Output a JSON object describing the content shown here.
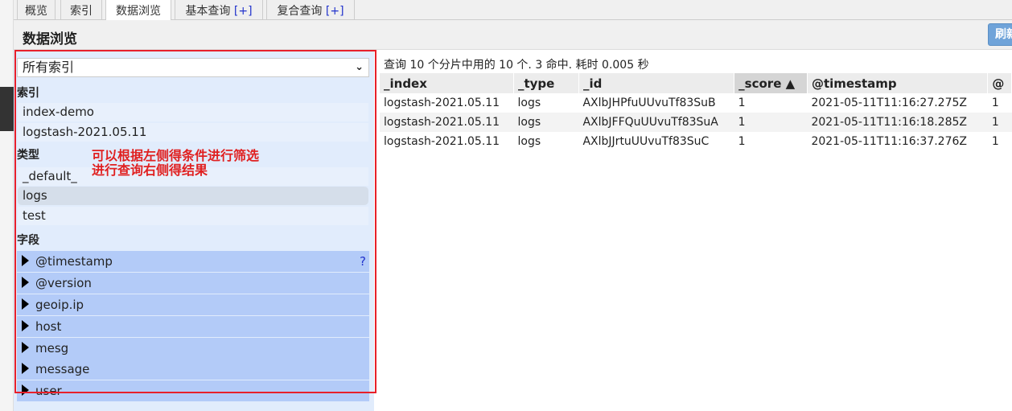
{
  "tabs": [
    {
      "label": "概览"
    },
    {
      "label": "索引"
    },
    {
      "label": "数据浏览"
    },
    {
      "label": "基本查询",
      "plus": "[+]"
    },
    {
      "label": "复合查询",
      "plus": "[+]"
    }
  ],
  "header": {
    "title": "数据浏览",
    "refresh_label": "刷新"
  },
  "sidebar": {
    "index_select": "所有索引",
    "index_heading": "索引",
    "indices": [
      "index-demo",
      "logstash-2021.05.11"
    ],
    "type_heading": "类型",
    "types": [
      "_default_",
      "logs",
      "test"
    ],
    "selected_type": "logs",
    "field_heading": "字段",
    "fields": [
      "@timestamp",
      "@version",
      "geoip.ip",
      "host",
      "mesg",
      "message",
      "user"
    ],
    "help": "?"
  },
  "annotation": {
    "line1": "可以根据左侧得条件进行筛选",
    "line2": "进行查询右侧得结果"
  },
  "results": {
    "summary": "查询 10 个分片中用的 10 个. 3 命中. 耗时 0.005 秒",
    "columns": [
      "_index",
      "_type",
      "_id",
      "_score ▲",
      "@timestamp",
      "@"
    ],
    "rows": [
      [
        "logstash-2021.05.11",
        "logs",
        "AXlbJHPfuUUvuTf83SuB",
        "1",
        "2021-05-11T11:16:27.275Z",
        "1"
      ],
      [
        "logstash-2021.05.11",
        "logs",
        "AXlbJFFQuUUvuTf83SuA",
        "1",
        "2021-05-11T11:16:18.285Z",
        "1"
      ],
      [
        "logstash-2021.05.11",
        "logs",
        "AXlbJJrtuUUvuTf83SuC",
        "1",
        "2021-05-11T11:16:37.276Z",
        "1"
      ]
    ]
  },
  "colors": {
    "accent_red": "#e8202a",
    "panel_bg": "#e1ecfc",
    "field_bg": "#b3cbf8",
    "link_blue": "#2233cc"
  }
}
